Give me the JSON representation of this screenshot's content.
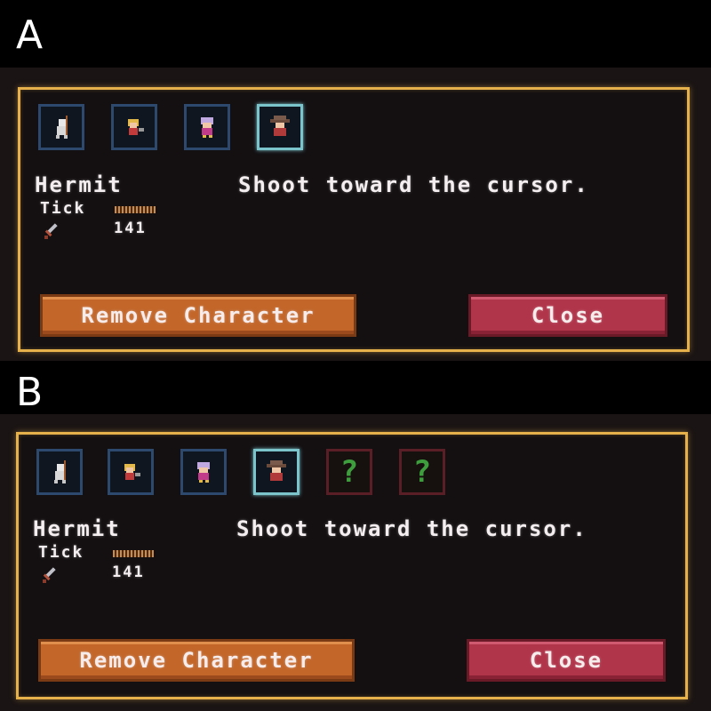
{
  "panels": [
    {
      "label": "A",
      "character_name": "Hermit",
      "description": "Shoot toward the cursor.",
      "stat_label": "Tick",
      "stat_value": "141",
      "remove_button": "Remove Character",
      "close_button": "Close",
      "slots": [
        {
          "type": "character",
          "icon": "skeleton-character-icon",
          "selected": false
        },
        {
          "type": "character",
          "icon": "blonde-character-icon",
          "selected": false
        },
        {
          "type": "character",
          "icon": "purple-hair-character-icon",
          "selected": false
        },
        {
          "type": "character",
          "icon": "hermit-character-icon",
          "selected": true
        }
      ]
    },
    {
      "label": "B",
      "character_name": "Hermit",
      "description": "Shoot toward the cursor.",
      "stat_label": "Tick",
      "stat_value": "141",
      "remove_button": "Remove Character",
      "close_button": "Close",
      "slots": [
        {
          "type": "character",
          "icon": "skeleton-character-icon",
          "selected": false
        },
        {
          "type": "character",
          "icon": "blonde-character-icon",
          "selected": false
        },
        {
          "type": "character",
          "icon": "purple-hair-character-icon",
          "selected": false
        },
        {
          "type": "character",
          "icon": "hermit-character-icon",
          "selected": true
        },
        {
          "type": "locked",
          "icon": "question-mark-icon",
          "glyph": "?"
        },
        {
          "type": "locked",
          "icon": "question-mark-icon",
          "glyph": "?"
        }
      ]
    }
  ],
  "colors": {
    "frame": "#e6b04a",
    "remove_button": "#c2662a",
    "close_button": "#b0344a",
    "selected_slot": "#7cc4cc",
    "slot": "#2d4a6e",
    "locked_slot": "#5a1e26",
    "question_mark": "#3e9e3e"
  }
}
